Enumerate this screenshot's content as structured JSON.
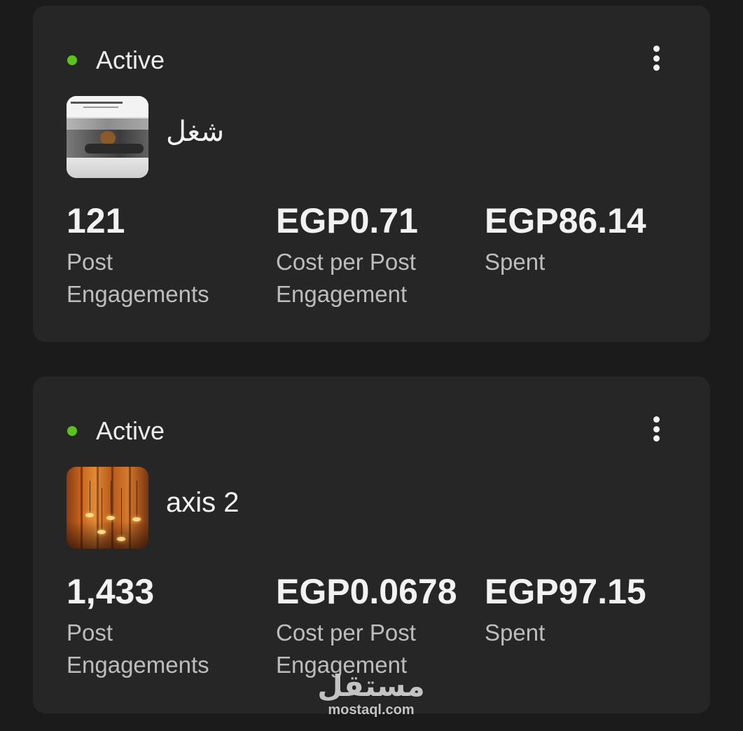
{
  "colors": {
    "page_background": "#1b1b1b",
    "card_background": "#262626",
    "status_active": "#5dc21e",
    "value_text": "#f2f2f2",
    "label_text": "#bdbdbd"
  },
  "campaigns": [
    {
      "status": "Active",
      "name": "شغل",
      "thumbnail_icon": "architecture-photo",
      "menu_icon": "more-vertical-icon",
      "metrics": [
        {
          "value": "121",
          "label": "Post Engagements"
        },
        {
          "value": "EGP0.71",
          "label": "Cost per Post Engagement"
        },
        {
          "value": "EGP86.14",
          "label": "Spent"
        }
      ]
    },
    {
      "status": "Active",
      "name": "axis 2",
      "thumbnail_icon": "pendant-lamps-photo",
      "menu_icon": "more-vertical-icon",
      "metrics": [
        {
          "value": "1,433",
          "label": "Post Engagements"
        },
        {
          "value": "EGP0.0678",
          "label": "Cost per Post Engagement"
        },
        {
          "value": "EGP97.15",
          "label": "Spent"
        }
      ]
    }
  ],
  "watermark": {
    "mark": "مستقل",
    "site": "mostaql.com"
  }
}
